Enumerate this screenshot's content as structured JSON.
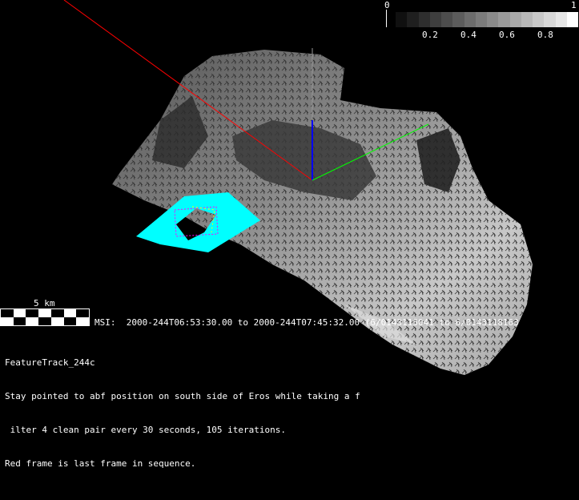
{
  "colorbar": {
    "min_label": "0",
    "max_label": "1",
    "tick_labels": [
      "0.2",
      "0.4",
      "0.6",
      "0.8"
    ],
    "steps": 16,
    "colors": [
      "#101010",
      "#1f1f1f",
      "#2e2e2e",
      "#3e3e3e",
      "#4d4d4d",
      "#5c5c5c",
      "#6c6c6c",
      "#7b7b7b",
      "#8a8a8a",
      "#9a9a9a",
      "#a9a9a9",
      "#b8b8b8",
      "#c8c8c8",
      "#d7d7d7",
      "#e6e6e6",
      "#ffffff"
    ]
  },
  "scale_bar": {
    "label": "5 km"
  },
  "msi_line": "MSI:  2000-244T06:53:30.00 to 2000-244T07:45:32.00 (6/0143115041 to 6/0143118163",
  "description": {
    "title": "FeatureTrack_244c",
    "lines": [
      "Stay pointed to abf position on south side of Eros while taking a f",
      " ilter 4 clean pair every 30 seconds, 105 iterations.",
      "Red frame is last frame in sequence."
    ]
  },
  "colors": {
    "x_axis": "#ff0000",
    "y_axis": "#00ff00",
    "z_axis": "#0000ff",
    "footprints": "#00ffff",
    "last_frame": "#ff0000"
  }
}
